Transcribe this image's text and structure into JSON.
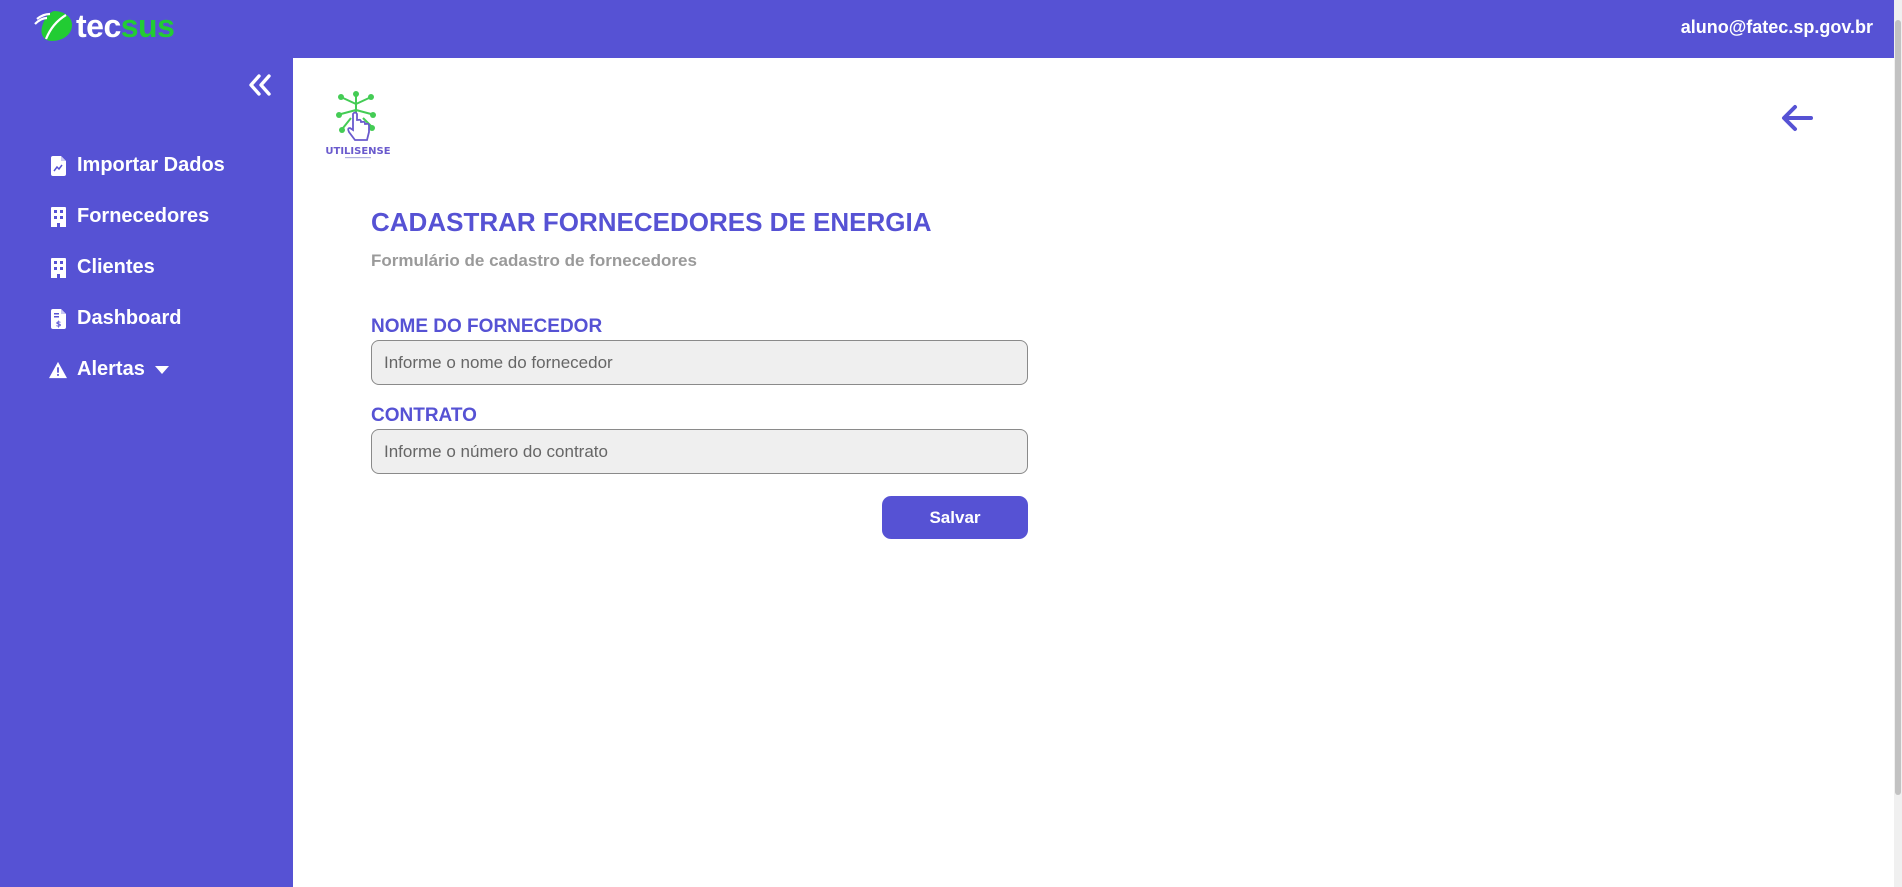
{
  "header": {
    "brand_prefix": "tec",
    "brand_suffix": "sus",
    "user_email": "aluno@fatec.sp.gov.br"
  },
  "sidebar": {
    "items": [
      {
        "label": "Importar Dados",
        "icon": "file-chart-icon"
      },
      {
        "label": "Fornecedores",
        "icon": "building-icon"
      },
      {
        "label": "Clientes",
        "icon": "building-icon"
      },
      {
        "label": "Dashboard",
        "icon": "file-invoice-dollar-icon"
      },
      {
        "label": "Alertas",
        "icon": "warning-icon"
      }
    ]
  },
  "main": {
    "logo_text": "UTILISENSE",
    "title": "CADASTRAR FORNECEDORES DE ENERGIA",
    "subtitle": "Formulário de cadastro de fornecedores",
    "fields": [
      {
        "label": "NOME DO FORNECEDOR",
        "placeholder": "Informe o nome do fornecedor",
        "value": ""
      },
      {
        "label": "CONTRATO",
        "placeholder": "Informe o número do contrato",
        "value": ""
      }
    ],
    "save_label": "Salvar"
  },
  "colors": {
    "primary": "#5652d4",
    "brand_green": "#22cc33",
    "subtitle_gray": "#9a9a9a",
    "input_bg": "#efefef"
  }
}
